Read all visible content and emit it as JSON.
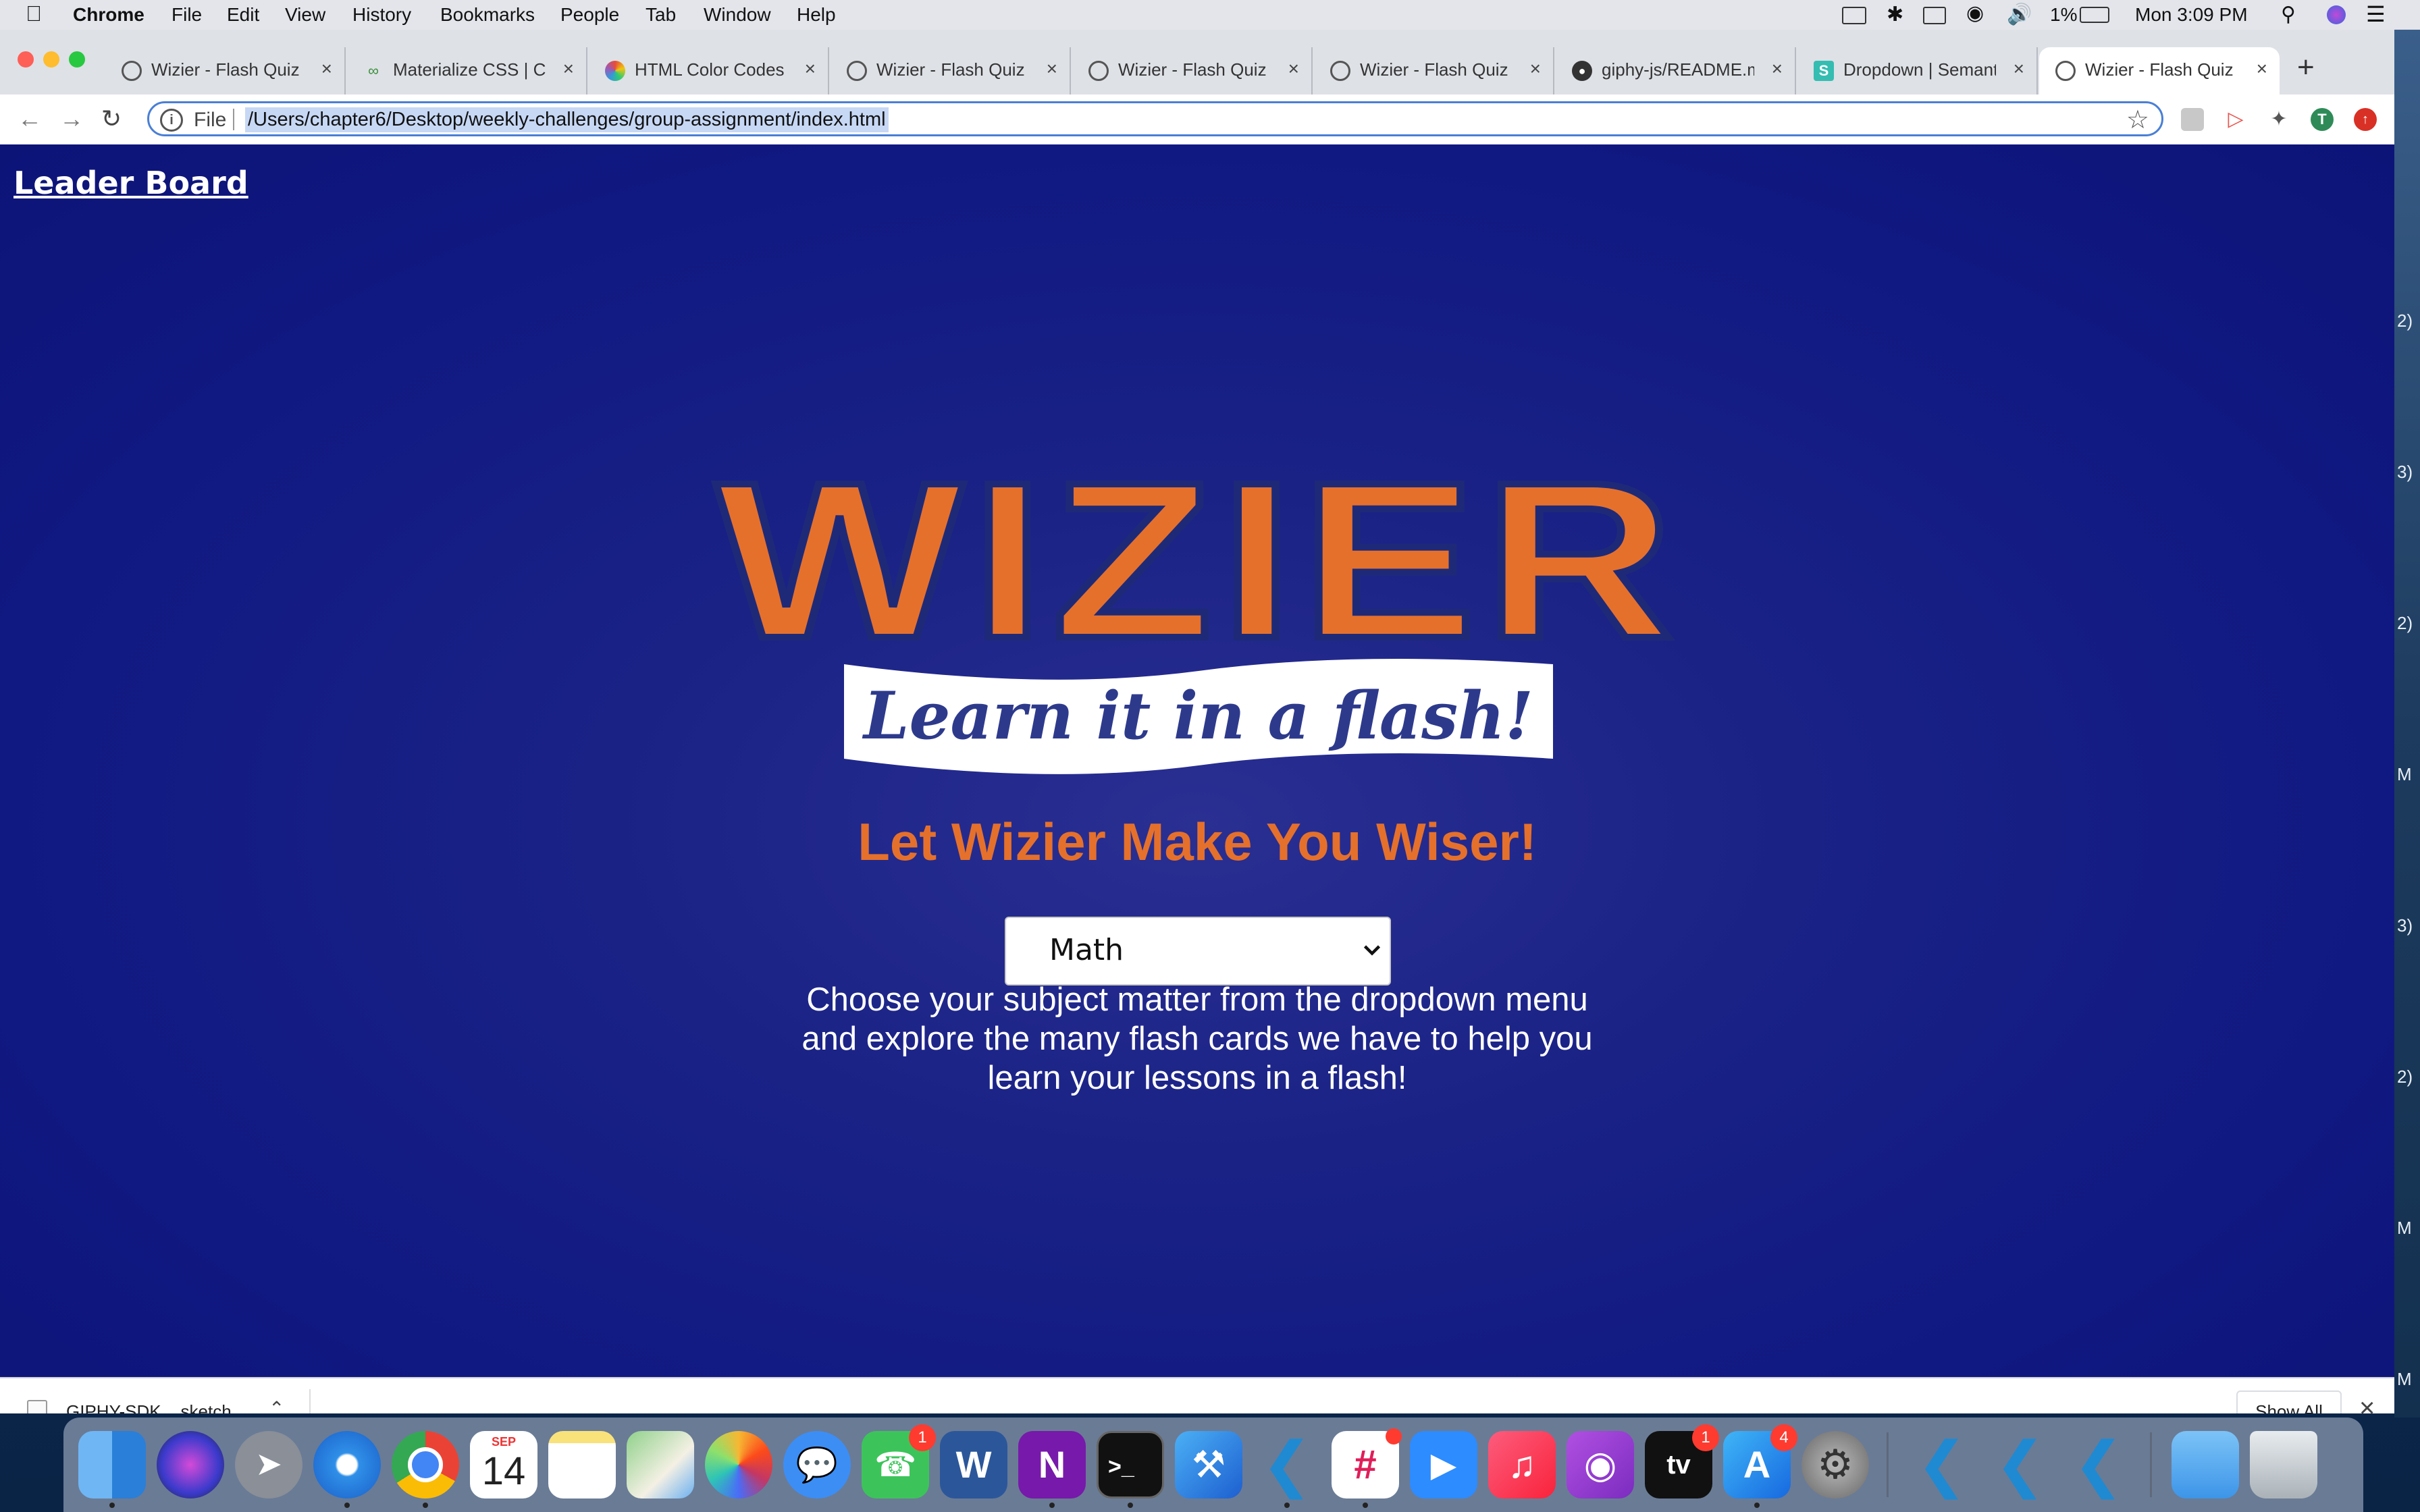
{
  "menubar": {
    "apple_icon": "apple-icon",
    "app_name": "Chrome",
    "menus": [
      "File",
      "Edit",
      "View",
      "History",
      "Bookmarks",
      "People",
      "Tab",
      "Window",
      "Help"
    ],
    "battery_percent": "1%",
    "clock": "Mon 3:09 PM"
  },
  "tabs": [
    {
      "title": "Wizier - Flash Quiz",
      "icon": "globe-icon"
    },
    {
      "title": "Materialize CSS | Co",
      "icon": "materialize-icon"
    },
    {
      "title": "HTML Color Codes",
      "icon": "color-wheel-icon"
    },
    {
      "title": "Wizier - Flash Quiz",
      "icon": "globe-icon"
    },
    {
      "title": "Wizier - Flash Quiz",
      "icon": "globe-icon"
    },
    {
      "title": "Wizier - Flash Quiz",
      "icon": "globe-icon"
    },
    {
      "title": "giphy-js/README.m",
      "icon": "github-icon"
    },
    {
      "title": "Dropdown | Semanti",
      "icon": "semantic-ui-icon"
    },
    {
      "title": "Wizier - Flash Quiz",
      "icon": "globe-icon",
      "active": true
    }
  ],
  "toolbar": {
    "scheme": "File",
    "url": "/Users/chapter6/Desktop/weekly-challenges/group-assignment/index.html",
    "profile_initial": "T"
  },
  "page": {
    "leaderboard_link": "Leader Board",
    "logo_text": "WIZIER",
    "logo_banner": "Learn it in a flash!",
    "tagline": "Let Wizier Make You Wiser!",
    "subject_select": {
      "selected": "Math"
    },
    "description": "Choose your subject matter from the dropdown menu and explore the many flash cards we have to help you learn your lessons in a flash!"
  },
  "downloads": {
    "file_name": "GIPHY-SDK....sketch",
    "show_all": "Show All"
  },
  "dock": {
    "calendar_month": "SEP",
    "calendar_day": "14",
    "facetime_badge": "1",
    "appletv_label": "tv",
    "appletv_badge": "1",
    "appstore_badge": "4"
  },
  "desktop_edge_marks": [
    "2)",
    "3)",
    "2)",
    "M",
    "3)",
    "2)",
    "M",
    "M"
  ],
  "colors": {
    "accent_orange": "#e5702c",
    "page_blue": "#101982",
    "logo_navy": "#1e2a78"
  }
}
